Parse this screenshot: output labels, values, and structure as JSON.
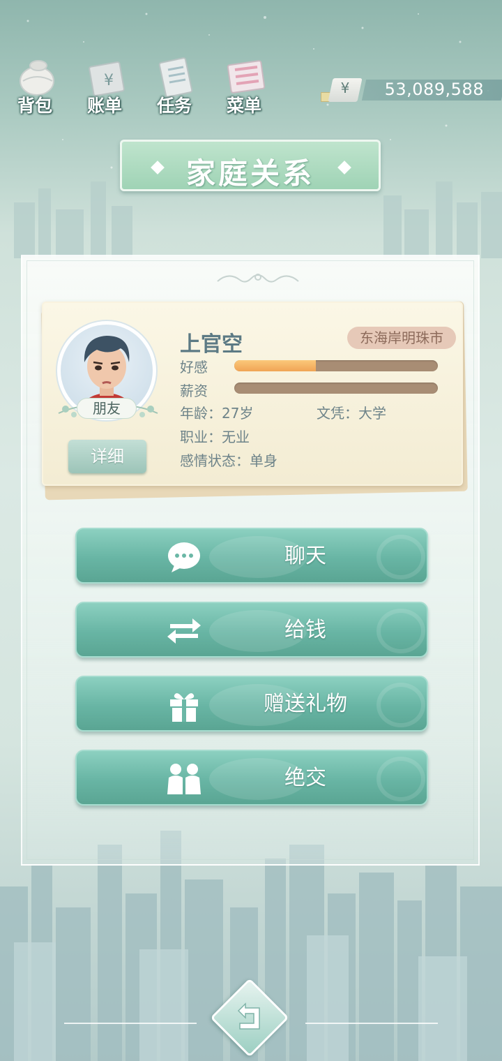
{
  "toolbar": {
    "items": [
      {
        "label": "背包",
        "icon": "bag-icon"
      },
      {
        "label": "账单",
        "icon": "bill-icon"
      },
      {
        "label": "任务",
        "icon": "task-icon"
      },
      {
        "label": "菜单",
        "icon": "menu-icon"
      }
    ]
  },
  "money": {
    "currency_symbol": "¥",
    "amount": "53,089,588"
  },
  "page": {
    "title": "家庭关系"
  },
  "profile": {
    "name": "上官空",
    "location": "东海岸明珠市",
    "relation": "朋友",
    "detail_label": "详细",
    "favor_label": "好感",
    "favor_value": 0.4,
    "salary_label": "薪资",
    "salary_value": 0.0,
    "age": "年龄：27岁",
    "education": "文凭：大学",
    "job": "职业：无业",
    "relationship_status": "感情状态：单身"
  },
  "actions": [
    {
      "label": "聊天",
      "icon": "chat-icon"
    },
    {
      "label": "给钱",
      "icon": "transfer-money-icon"
    },
    {
      "label": "赠送礼物",
      "icon": "gift-icon"
    },
    {
      "label": "绝交",
      "icon": "break-friendship-icon"
    }
  ],
  "colors": {
    "accent": "#68b5a4",
    "favor_bar": "#f0a455",
    "bar_track": "#a88d74"
  }
}
